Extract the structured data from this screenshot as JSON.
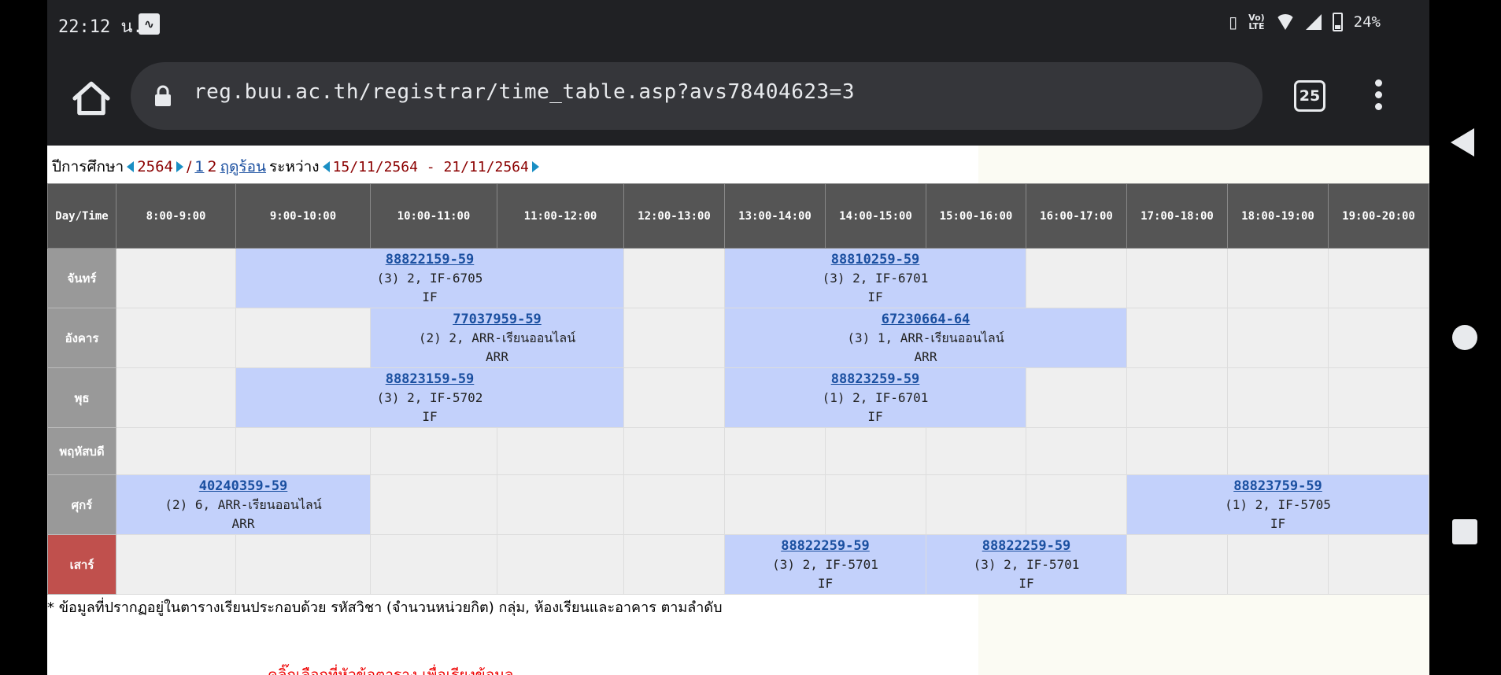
{
  "status_bar": {
    "time": "22:12 น.",
    "notification_icon": "app-notification-icon",
    "volte": "Vo)\nLTE",
    "battery": "24%"
  },
  "browser": {
    "url": "reg.buu.ac.th/registrar/time_table.asp?avs78404623=3",
    "tab_count": "25"
  },
  "page": {
    "year_label": "ปีการศึกษา",
    "year": "2564",
    "sep": "/",
    "semester_link": "1",
    "semester_2": "2",
    "summer_link": "ฤดูร้อน",
    "between_label": "ระหว่าง",
    "date_range": "15/11/2564 - 21/11/2564",
    "footnote": "* ข้อมูลที่ปรากฏอยู่ในตารางเรียนประกอบด้วย รหัสวิชา (จำนวนหน่วยกิต) กลุ่ม, ห้องเรียนและอาคาร ตามลำดับ",
    "red_hint": "คลิ๊กเลือกที่หัวข้อตาราง เพื่อเรียงข้อมูล"
  },
  "timetable": {
    "header_day": "Day/Time",
    "slots": [
      "8:00-9:00",
      "9:00-10:00",
      "10:00-11:00",
      "11:00-12:00",
      "12:00-13:00",
      "13:00-14:00",
      "14:00-15:00",
      "15:00-16:00",
      "16:00-17:00",
      "17:00-18:00",
      "18:00-19:00",
      "19:00-20:00"
    ],
    "days": [
      "จันทร์",
      "อังคาร",
      "พุธ",
      "พฤหัสบดี",
      "ศุกร์",
      "เสาร์"
    ],
    "courses": {
      "mon_1": {
        "code": "88822159-59",
        "info": "(3) 2, IF-6705",
        "bld": "IF"
      },
      "mon_2": {
        "code": "88810259-59",
        "info": "(3) 2, IF-6701",
        "bld": "IF"
      },
      "tue_1": {
        "code": "77037959-59",
        "info": "(2) 2, ARR-เรียนออนไลน์",
        "bld": "ARR"
      },
      "tue_2": {
        "code": "67230664-64",
        "info": "(3) 1, ARR-เรียนออนไลน์",
        "bld": "ARR"
      },
      "wed_1": {
        "code": "88823159-59",
        "info": "(3) 2, IF-5702",
        "bld": "IF"
      },
      "wed_2": {
        "code": "88823259-59",
        "info": "(1) 2, IF-6701",
        "bld": "IF"
      },
      "fri_1": {
        "code": "40240359-59",
        "info": "(2) 6, ARR-เรียนออนไลน์",
        "bld": "ARR"
      },
      "fri_2": {
        "code": "88823759-59",
        "info": "(1) 2, IF-5705",
        "bld": "IF"
      },
      "sat_1": {
        "code": "88822259-59",
        "info": "(3) 2, IF-5701",
        "bld": "IF"
      },
      "sat_2": {
        "code": "88822259-59",
        "info": "(3) 2, IF-5701",
        "bld": "IF"
      }
    }
  }
}
